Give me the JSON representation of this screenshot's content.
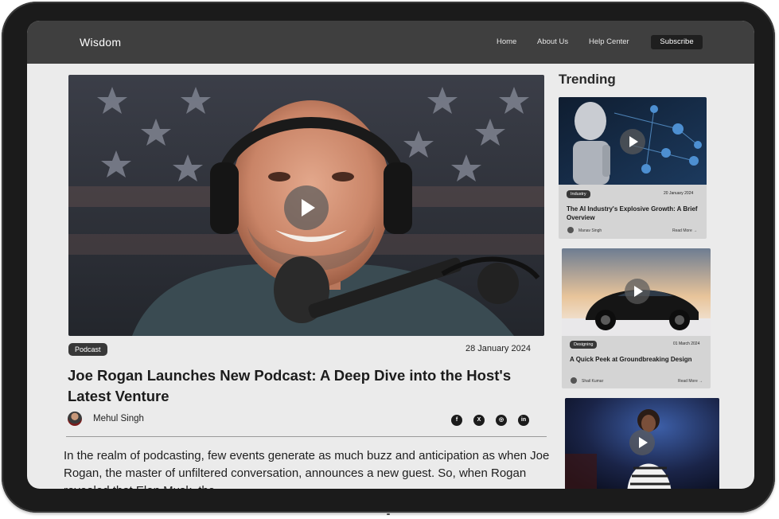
{
  "nav": {
    "logo": "Wisdom",
    "links": [
      "Home",
      "About Us",
      "Help Center"
    ],
    "subscribe": "Subscribe"
  },
  "article": {
    "tag": "Podcast",
    "date": "28 January 2024",
    "title": "Joe Rogan Launches New Podcast: A Deep Dive into the Host's Latest Venture",
    "author": "Mehul Singh",
    "social": [
      "facebook-icon",
      "x-icon",
      "instagram-icon",
      "linkedin-icon"
    ],
    "body": "In the realm of podcasting, few events generate as much buzz and anticipation as when Joe Rogan, the master of unfiltered conversation, announces a new guest. So, when Rogan revealed that Elon Musk, the"
  },
  "trending": {
    "title": "Trending",
    "cards": [
      {
        "tag": "Industry",
        "date": "20 January 2024",
        "title": "The AI Industry's Explosive Growth: A Brief Overview",
        "author": "Manav Singh",
        "read_more": "Read More →"
      },
      {
        "tag": "Designing",
        "date": "01 March 2024",
        "title": "A Quick Peek at Groundbreaking Design",
        "author": "Shail Kumar",
        "read_more": "Read More →"
      }
    ]
  }
}
